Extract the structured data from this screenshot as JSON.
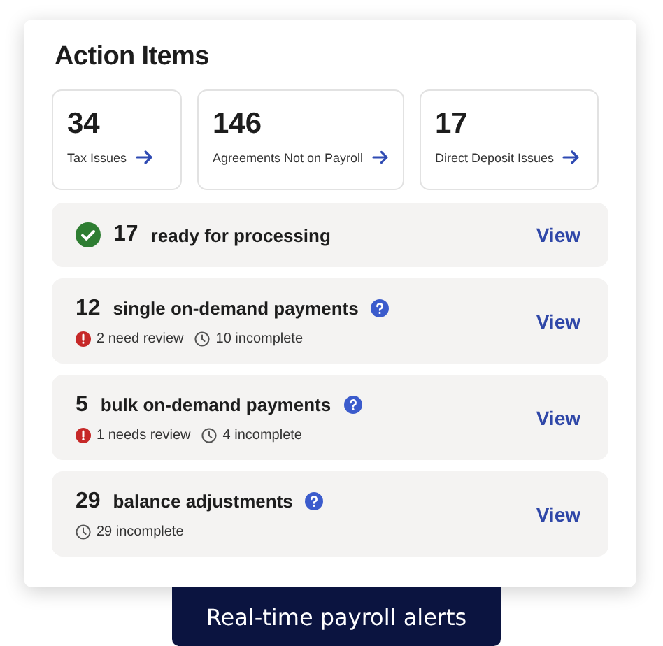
{
  "title": "Action Items",
  "stats": [
    {
      "count": "34",
      "label": "Tax Issues"
    },
    {
      "count": "146",
      "label": "Agreements Not on Payroll"
    },
    {
      "count": "17",
      "label": "Direct Deposit Issues"
    }
  ],
  "items": [
    {
      "kind": "ready",
      "count": "17",
      "label": "ready for processing",
      "action": "View"
    },
    {
      "kind": "detailed",
      "count": "12",
      "label": "single on-demand payments",
      "action": "View",
      "statuses": [
        {
          "kind": "review",
          "text": "2 need review"
        },
        {
          "kind": "incomplete",
          "text": "10 incomplete"
        }
      ]
    },
    {
      "kind": "detailed",
      "count": "5",
      "label": "bulk on-demand payments",
      "action": "View",
      "statuses": [
        {
          "kind": "review",
          "text": "1 needs review"
        },
        {
          "kind": "incomplete",
          "text": "4 incomplete"
        }
      ]
    },
    {
      "kind": "detailed",
      "count": "29",
      "label": "balance adjustments",
      "action": "View",
      "statuses": [
        {
          "kind": "incomplete",
          "text": "29 incomplete"
        }
      ]
    }
  ],
  "banner": "Real-time payroll alerts"
}
